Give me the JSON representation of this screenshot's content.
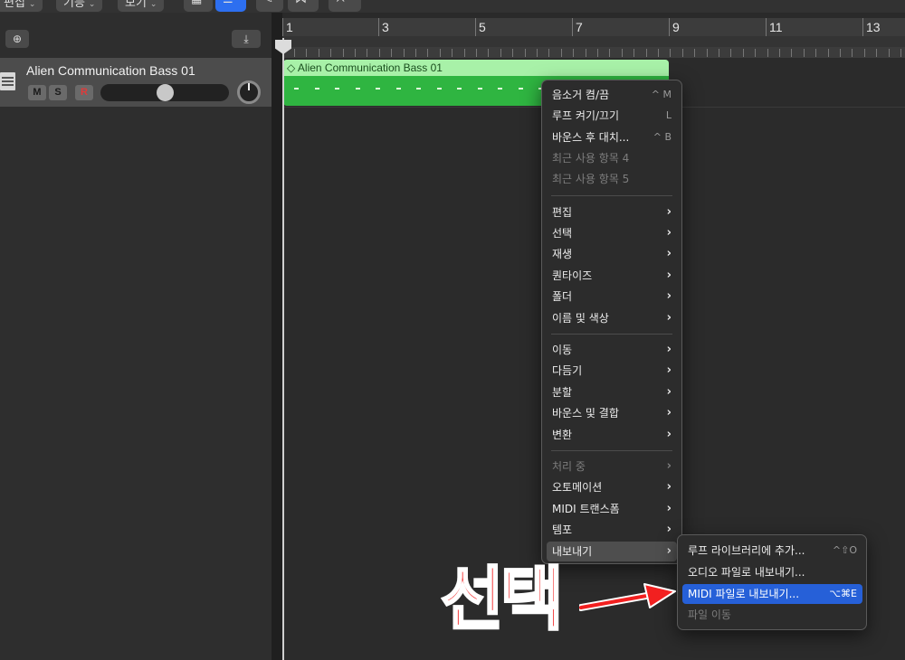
{
  "toolbar": {
    "items": [
      {
        "label": "편집",
        "chev": "⌄"
      },
      {
        "label": "기능",
        "chev": "⌄"
      },
      {
        "label": "보기",
        "chev": "⌄"
      }
    ]
  },
  "track": {
    "name": "Alien Communication Bass 01",
    "mute": "M",
    "solo": "S",
    "record": "R",
    "volume": 0.5
  },
  "ruler": {
    "bars": [
      "1",
      "3",
      "5",
      "7",
      "9",
      "11",
      "13"
    ]
  },
  "region": {
    "title": "◇ Alien Communication Bass 01",
    "color": "#2fb541",
    "title_color": "#a8f1a8"
  },
  "context_menu": {
    "items": [
      {
        "label": "음소거 켬/끔",
        "shortcut": "^ M",
        "dim": false
      },
      {
        "label": "루프 켜기/끄기",
        "shortcut": "L",
        "dim": false
      },
      {
        "label": "바운스 후 대치...",
        "shortcut": "^ B",
        "dim": false
      },
      {
        "label": "최근 사용 항목 4",
        "shortcut": "",
        "dim": true
      },
      {
        "label": "최근 사용 항목 5",
        "shortcut": "",
        "dim": true
      },
      {
        "label": "편집",
        "submenu": true,
        "dim": false
      },
      {
        "label": "선택",
        "submenu": true,
        "dim": false
      },
      {
        "label": "재생",
        "submenu": true,
        "dim": false
      },
      {
        "label": "퀀타이즈",
        "submenu": true,
        "dim": false
      },
      {
        "label": "폴더",
        "submenu": true,
        "dim": false
      },
      {
        "label": "이름 및 색상",
        "submenu": true,
        "dim": false
      },
      {
        "label": "이동",
        "submenu": true,
        "dim": false
      },
      {
        "label": "다듬기",
        "submenu": true,
        "dim": false
      },
      {
        "label": "분할",
        "submenu": true,
        "dim": false
      },
      {
        "label": "바운스 및 결합",
        "submenu": true,
        "dim": false
      },
      {
        "label": "변환",
        "submenu": true,
        "dim": false
      },
      {
        "label": "처리 중",
        "submenu": true,
        "dim": true
      },
      {
        "label": "오토메이션",
        "submenu": true,
        "dim": false
      },
      {
        "label": "MIDI 트랜스폼",
        "submenu": true,
        "dim": false
      },
      {
        "label": "템포",
        "submenu": true,
        "dim": false
      },
      {
        "label": "내보내기",
        "submenu": true,
        "dim": false,
        "active": true
      }
    ]
  },
  "export_submenu": {
    "items": [
      {
        "label": "루프 라이브러리에 추가...",
        "shortcut": "^⇧O",
        "dim": false
      },
      {
        "label": "오디오 파일로 내보내기...",
        "shortcut": "",
        "dim": false
      },
      {
        "label": "MIDI 파일로 내보내기...",
        "shortcut": "⌥⌘E",
        "dim": false,
        "selected": true
      },
      {
        "label": "파일 이동",
        "shortcut": "",
        "dim": true
      }
    ]
  },
  "annotation": {
    "text": "선택",
    "color": "#f22020"
  },
  "icons": {
    "submenu_arrow": "›",
    "add_track": "⊕",
    "download": "⤓"
  }
}
